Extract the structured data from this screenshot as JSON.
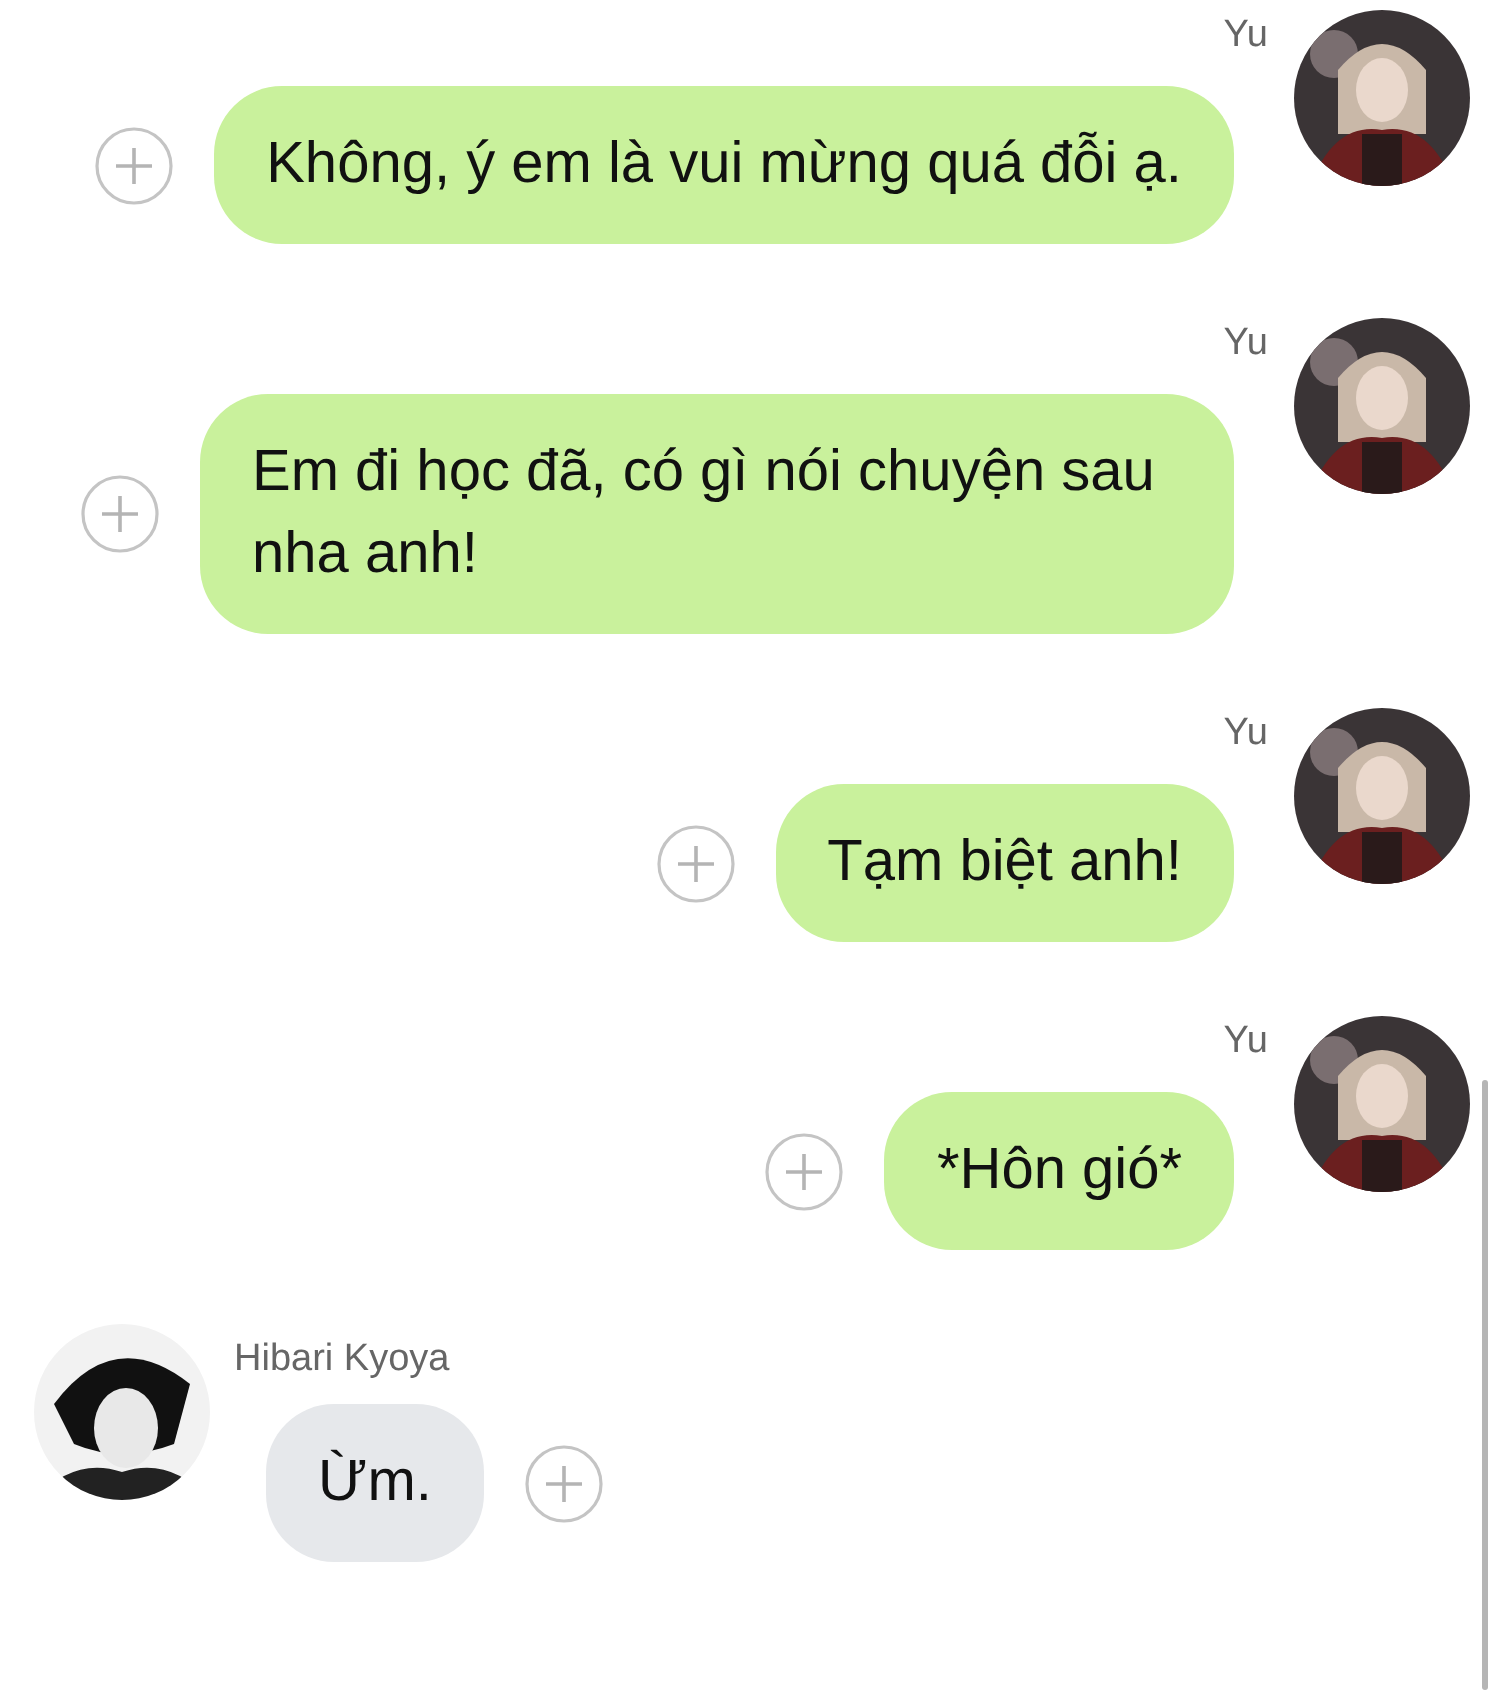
{
  "messages": [
    {
      "kind": "outgoing",
      "sender": "Yu",
      "text": "Không, ý em là vui mừng quá đỗi ạ."
    },
    {
      "kind": "outgoing",
      "sender": "Yu",
      "text": "Em đi học đã, có gì nói chuyện sau nha anh!"
    },
    {
      "kind": "outgoing",
      "sender": "Yu",
      "text": "Tạm biệt anh!"
    },
    {
      "kind": "outgoing",
      "sender": "Yu",
      "text": "*Hôn gió*"
    },
    {
      "kind": "incoming",
      "sender": "Hibari Kyoya",
      "text": "Ừm."
    }
  ]
}
